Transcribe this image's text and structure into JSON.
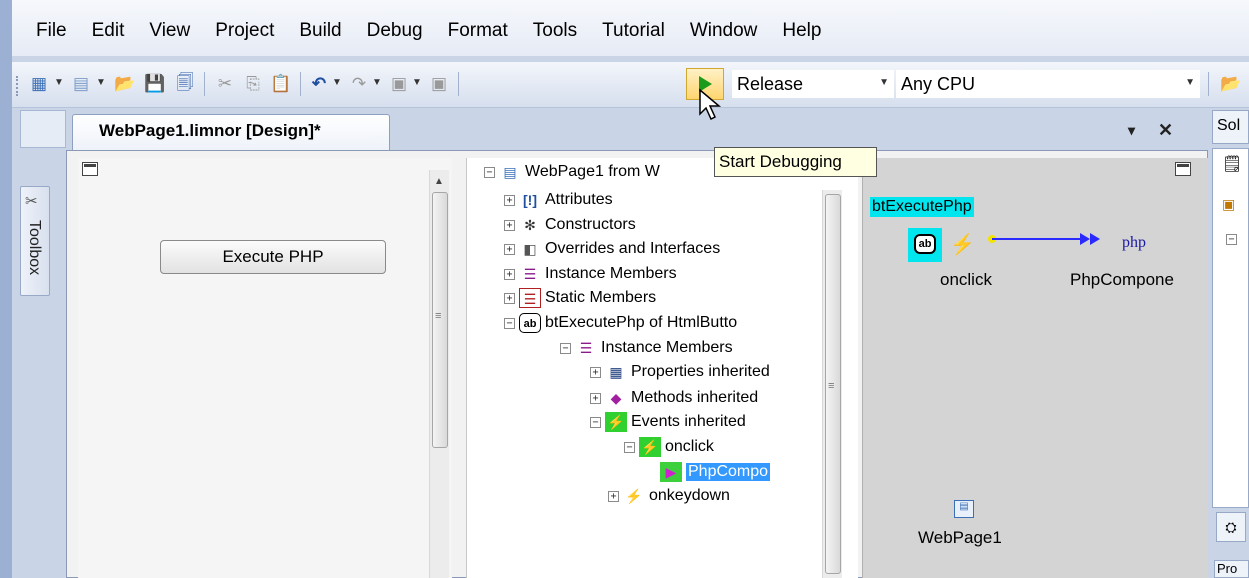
{
  "menu": [
    "File",
    "Edit",
    "View",
    "Project",
    "Build",
    "Debug",
    "Format",
    "Tools",
    "Tutorial",
    "Window",
    "Help"
  ],
  "toolbar": {
    "config_value": "Release",
    "platform_value": "Any CPU",
    "tooltip": "Start Debugging"
  },
  "doc_tab": {
    "title": "WebPage1.limnor [Design]*",
    "dropdown_glyph": "▾",
    "close_glyph": "✕"
  },
  "toolbox": {
    "label": "Toolbox"
  },
  "designer": {
    "button_label": "Execute PHP"
  },
  "tree": {
    "root": "WebPage1 from W",
    "items": [
      "Attributes",
      "Constructors",
      "Overrides and Interfaces",
      "Instance Members",
      "Static Members",
      "btExecutePhp of HtmlButto",
      "Instance Members",
      "Properties inherited",
      "Methods inherited",
      "Events inherited",
      "onclick",
      "PhpCompo",
      "onkeydown"
    ]
  },
  "diagram": {
    "selected_label": "btExecutePhp",
    "event_label": "onclick",
    "target_label": "PhpCompone",
    "php_text": "php",
    "page_label": "WebPage1"
  },
  "right_panel": {
    "tab": "Sol",
    "bottom_tab": "Pro"
  },
  "colors": {
    "accent_cyan": "#00e5ee",
    "selection": "#3399ff",
    "tooltip_bg": "#ffffe1"
  }
}
